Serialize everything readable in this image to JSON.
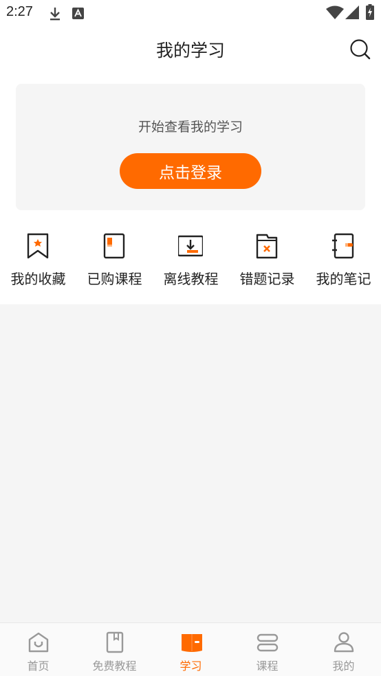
{
  "status_bar": {
    "time": "2:27",
    "icons": [
      "download-icon",
      "keyboard-a-icon",
      "wifi-icon",
      "signal-icon",
      "battery-charging-icon"
    ]
  },
  "header": {
    "title": "我的学习",
    "search_icon": "search-icon"
  },
  "login_card": {
    "prompt": "开始查看我的学习",
    "button_label": "点击登录"
  },
  "shortcuts": [
    {
      "label": "我的收藏",
      "icon": "bookmark-icon"
    },
    {
      "label": "已购课程",
      "icon": "purchased-book-icon"
    },
    {
      "label": "离线教程",
      "icon": "offline-download-icon"
    },
    {
      "label": "错题记录",
      "icon": "wrong-answer-folder-icon"
    },
    {
      "label": "我的笔记",
      "icon": "notebook-icon"
    }
  ],
  "bottom_nav": [
    {
      "label": "首页",
      "icon": "home-icon",
      "active": false
    },
    {
      "label": "免费教程",
      "icon": "free-book-icon",
      "active": false
    },
    {
      "label": "学习",
      "icon": "study-book-icon",
      "active": true
    },
    {
      "label": "课程",
      "icon": "course-scroll-icon",
      "active": false
    },
    {
      "label": "我的",
      "icon": "profile-icon",
      "active": false
    }
  ],
  "colors": {
    "accent": "#ff6a00",
    "accent_light": "#ffb27a",
    "nav_inactive": "#999999",
    "background": "#f5f5f5"
  }
}
